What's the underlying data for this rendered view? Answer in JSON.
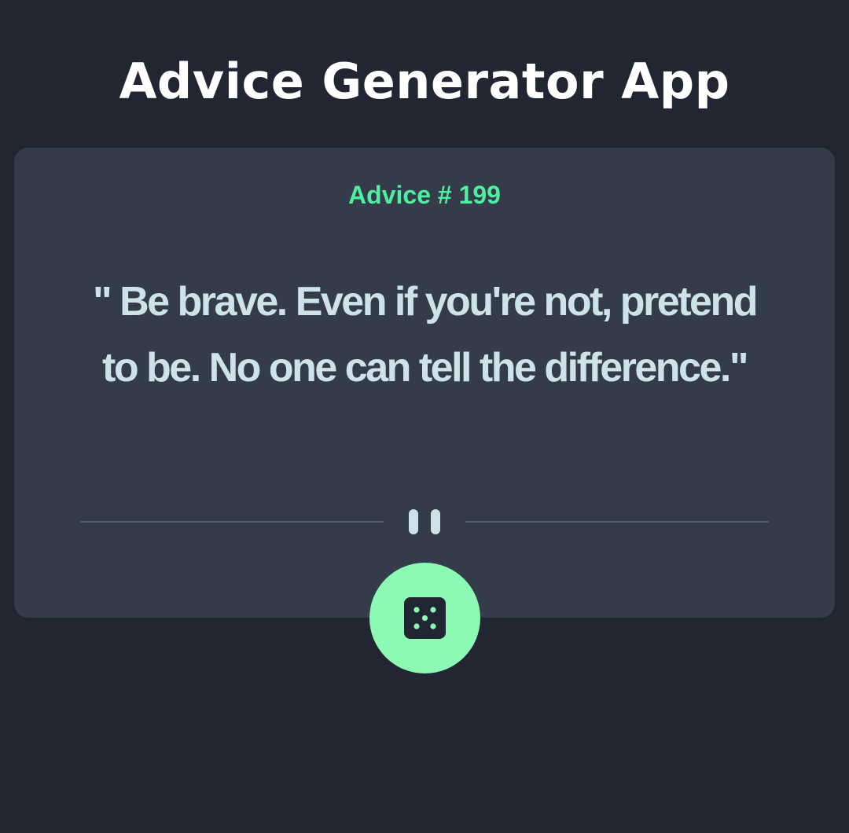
{
  "header": {
    "title": "Advice Generator App"
  },
  "card": {
    "advice_id_label": "Advice # 199",
    "advice_text": "\" Be brave. Even if you're not, pretend to be. No one can tell the difference.\"",
    "divider_icon": "pause-icon",
    "dice_button_icon": "dice-icon"
  },
  "colors": {
    "background": "#222632",
    "card": "#343b49",
    "accent": "#52ffa8",
    "button": "#8cf9b4",
    "text": "#cee3e9",
    "divider": "#4f5d74"
  }
}
